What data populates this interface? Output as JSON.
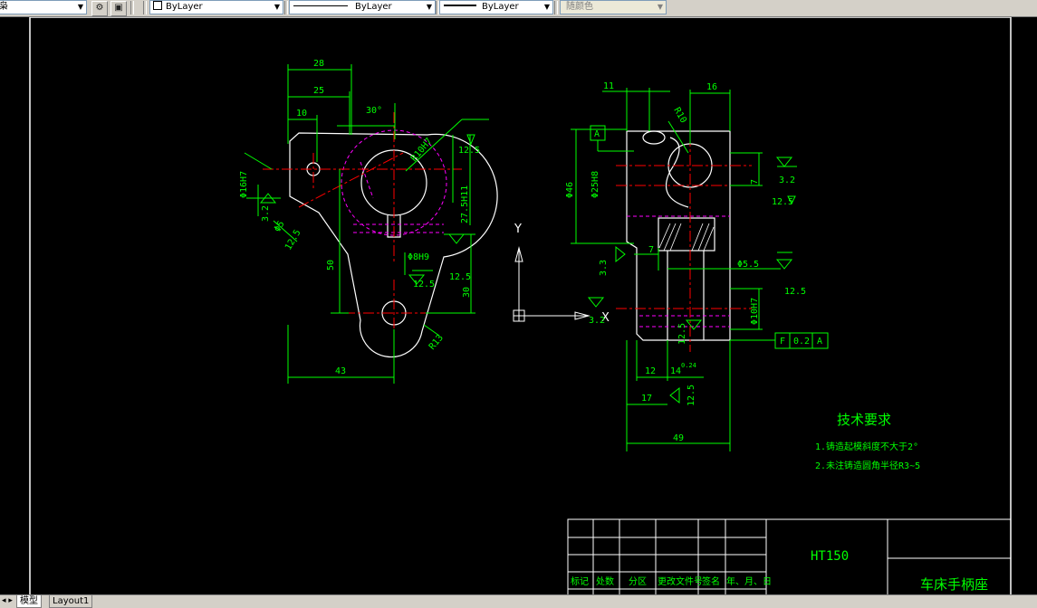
{
  "toolbar": {
    "layer_symbol": "⏷",
    "layer_dropdown": "ByLayer",
    "linetype_dropdown": "ByLayer",
    "lineweight_dropdown": "ByLayer",
    "plotstyle_dropdown": "随颜色"
  },
  "tabs": {
    "model": "模型",
    "layout1": "Layout1"
  },
  "drawing": {
    "colors": {
      "outline": "#ffffff",
      "dim": "#00ff00",
      "center": "#ff0000",
      "hidden": "#ff00ff",
      "ucs": "#ffffff"
    },
    "view_left": {
      "dims": [
        "28",
        "25",
        "10",
        "30°",
        "R10H7",
        "12.5",
        "Φ16H7",
        "3.2",
        "27.5H11",
        "Φ8H9",
        "50",
        "30",
        "12.5",
        "12.5",
        "R13",
        "43",
        "Φ5",
        "12.5"
      ]
    },
    "view_right": {
      "dims": [
        "11",
        "16",
        "R10",
        "A",
        "Φ46",
        "Φ25H8",
        "7",
        "3.2",
        "12.5",
        "7",
        "3.3",
        "Φ5.5",
        "12.5",
        "Φ10H7",
        "12.5",
        "3.2",
        "12",
        "14",
        "0.24",
        "12.5",
        "17",
        "49",
        "F",
        "0.2",
        "A"
      ]
    },
    "ucs": {
      "y": "Y",
      "x": "X"
    },
    "tech_req": {
      "title": "技术要求",
      "line1": "1.铸造起模斜度不大于2°",
      "line2": "2.未注铸造圆角半径R3~5"
    },
    "title_block": {
      "material": "HT150",
      "part_name": "车床手柄座",
      "headers": [
        "标记",
        "处数",
        "分区",
        "更改文件号",
        "签名",
        "年、月、日"
      ]
    }
  }
}
